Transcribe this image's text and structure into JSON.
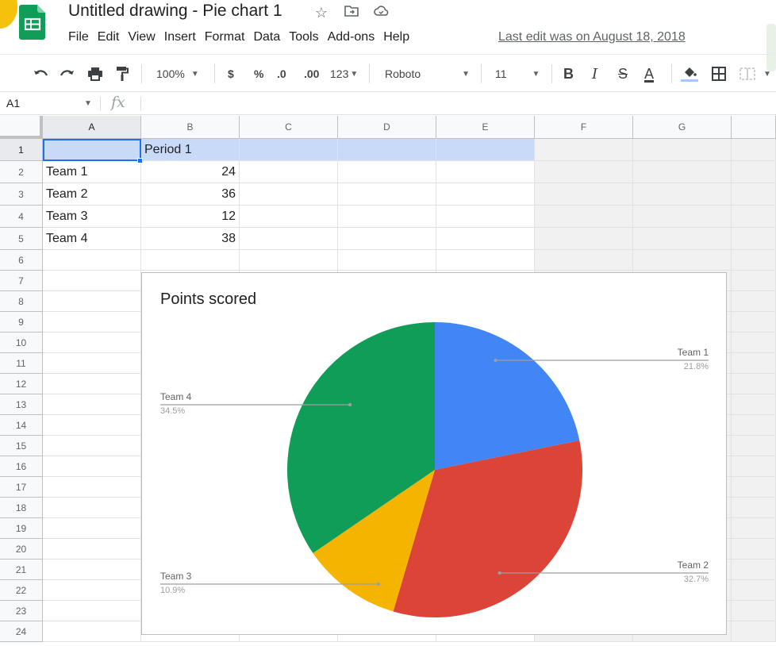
{
  "header": {
    "doc_title": "Untitled drawing - Pie chart 1",
    "last_edit": "Last edit was on August 18, 2018",
    "menu": [
      "File",
      "Edit",
      "View",
      "Insert",
      "Format",
      "Data",
      "Tools",
      "Add-ons",
      "Help"
    ]
  },
  "toolbar": {
    "zoom": "100%",
    "currency": "$",
    "percent": "%",
    "dec_less": ".0",
    "dec_more": ".00",
    "more_formats": "123",
    "font": "Roboto",
    "font_size": "11",
    "bold": "B",
    "italic": "I",
    "strike": "S",
    "text_color": "A"
  },
  "formula_bar": {
    "name_box": "A1",
    "fx": "fx",
    "value": ""
  },
  "grid": {
    "columns": [
      "A",
      "B",
      "C",
      "D",
      "E",
      "F",
      "G"
    ],
    "rows": [
      "1",
      "2",
      "3",
      "4",
      "5",
      "6",
      "7",
      "8",
      "9",
      "10",
      "11",
      "12",
      "13",
      "14",
      "15",
      "16",
      "17",
      "18",
      "19",
      "20",
      "21",
      "22",
      "23",
      "24"
    ],
    "cells": {
      "A1": "",
      "B1": "Period 1",
      "A2": "Team 1",
      "B2": "24",
      "A3": "Team 2",
      "B3": "36",
      "A4": "Team 3",
      "B4": "12",
      "A5": "Team 4",
      "B5": "38"
    }
  },
  "chart_data": {
    "type": "pie",
    "title": "Points scored",
    "categories": [
      "Team 1",
      "Team 2",
      "Team 3",
      "Team 4"
    ],
    "values": [
      24,
      36,
      12,
      38
    ],
    "percent_labels": [
      "21.8%",
      "32.7%",
      "10.9%",
      "34.5%"
    ],
    "colors": [
      "#4285f4",
      "#db4437",
      "#f4b400",
      "#0f9d58"
    ],
    "legend": "labeled"
  }
}
